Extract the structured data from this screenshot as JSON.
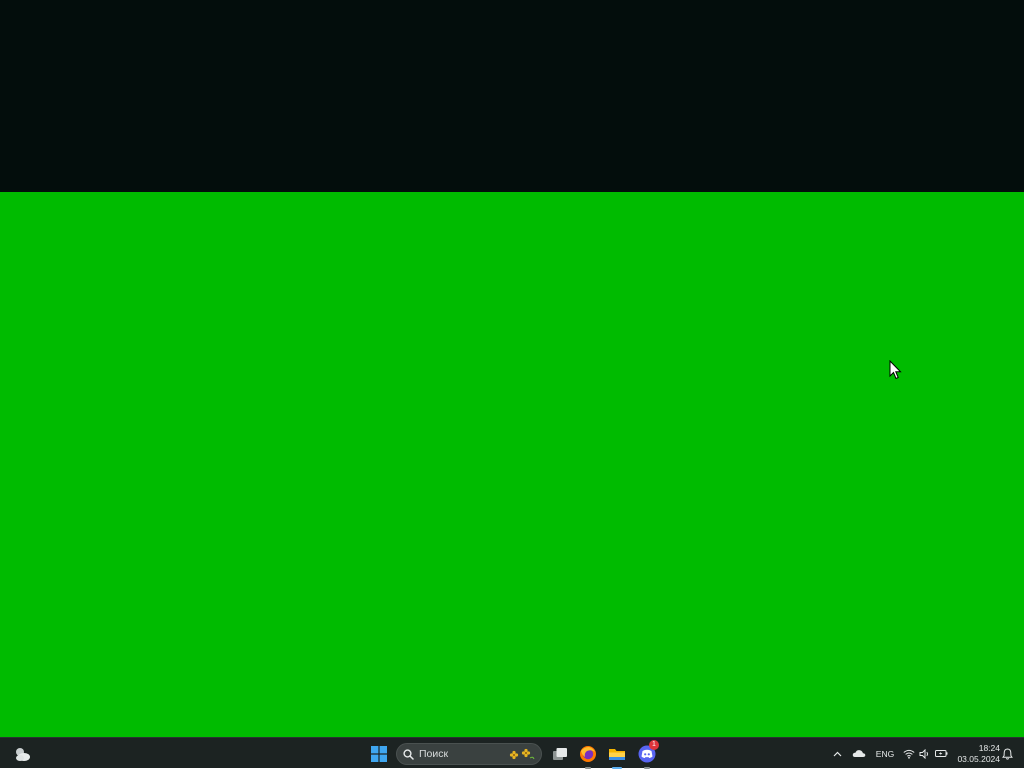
{
  "desktop": {
    "top_color": "#030d0c",
    "wallpaper_color": "#00bb00"
  },
  "taskbar": {
    "background": "#1c2322",
    "weather_icon": "weather-partly-cloudy-icon",
    "start_icon": "windows-start-icon",
    "search": {
      "icon": "search-icon",
      "placeholder": "Поиск",
      "decoration_icon": "flowers-doodle-icon"
    },
    "apps": [
      {
        "name": "task-view",
        "icon": "task-view-icon",
        "running": false
      },
      {
        "name": "firefox",
        "icon": "firefox-icon",
        "running": true
      },
      {
        "name": "file-explorer",
        "icon": "folder-icon",
        "running": true
      },
      {
        "name": "discord",
        "icon": "discord-icon",
        "running": true,
        "badge": "1"
      }
    ]
  },
  "tray": {
    "chevron_icon": "chevron-up-icon",
    "onedrive_icon": "cloud-icon",
    "language": "ENG",
    "wifi_icon": "wifi-icon",
    "volume_icon": "volume-icon",
    "battery_icon": "battery-charging-icon",
    "time": "18:24",
    "date": "03.05.2024",
    "notification_icon": "bell-icon"
  }
}
